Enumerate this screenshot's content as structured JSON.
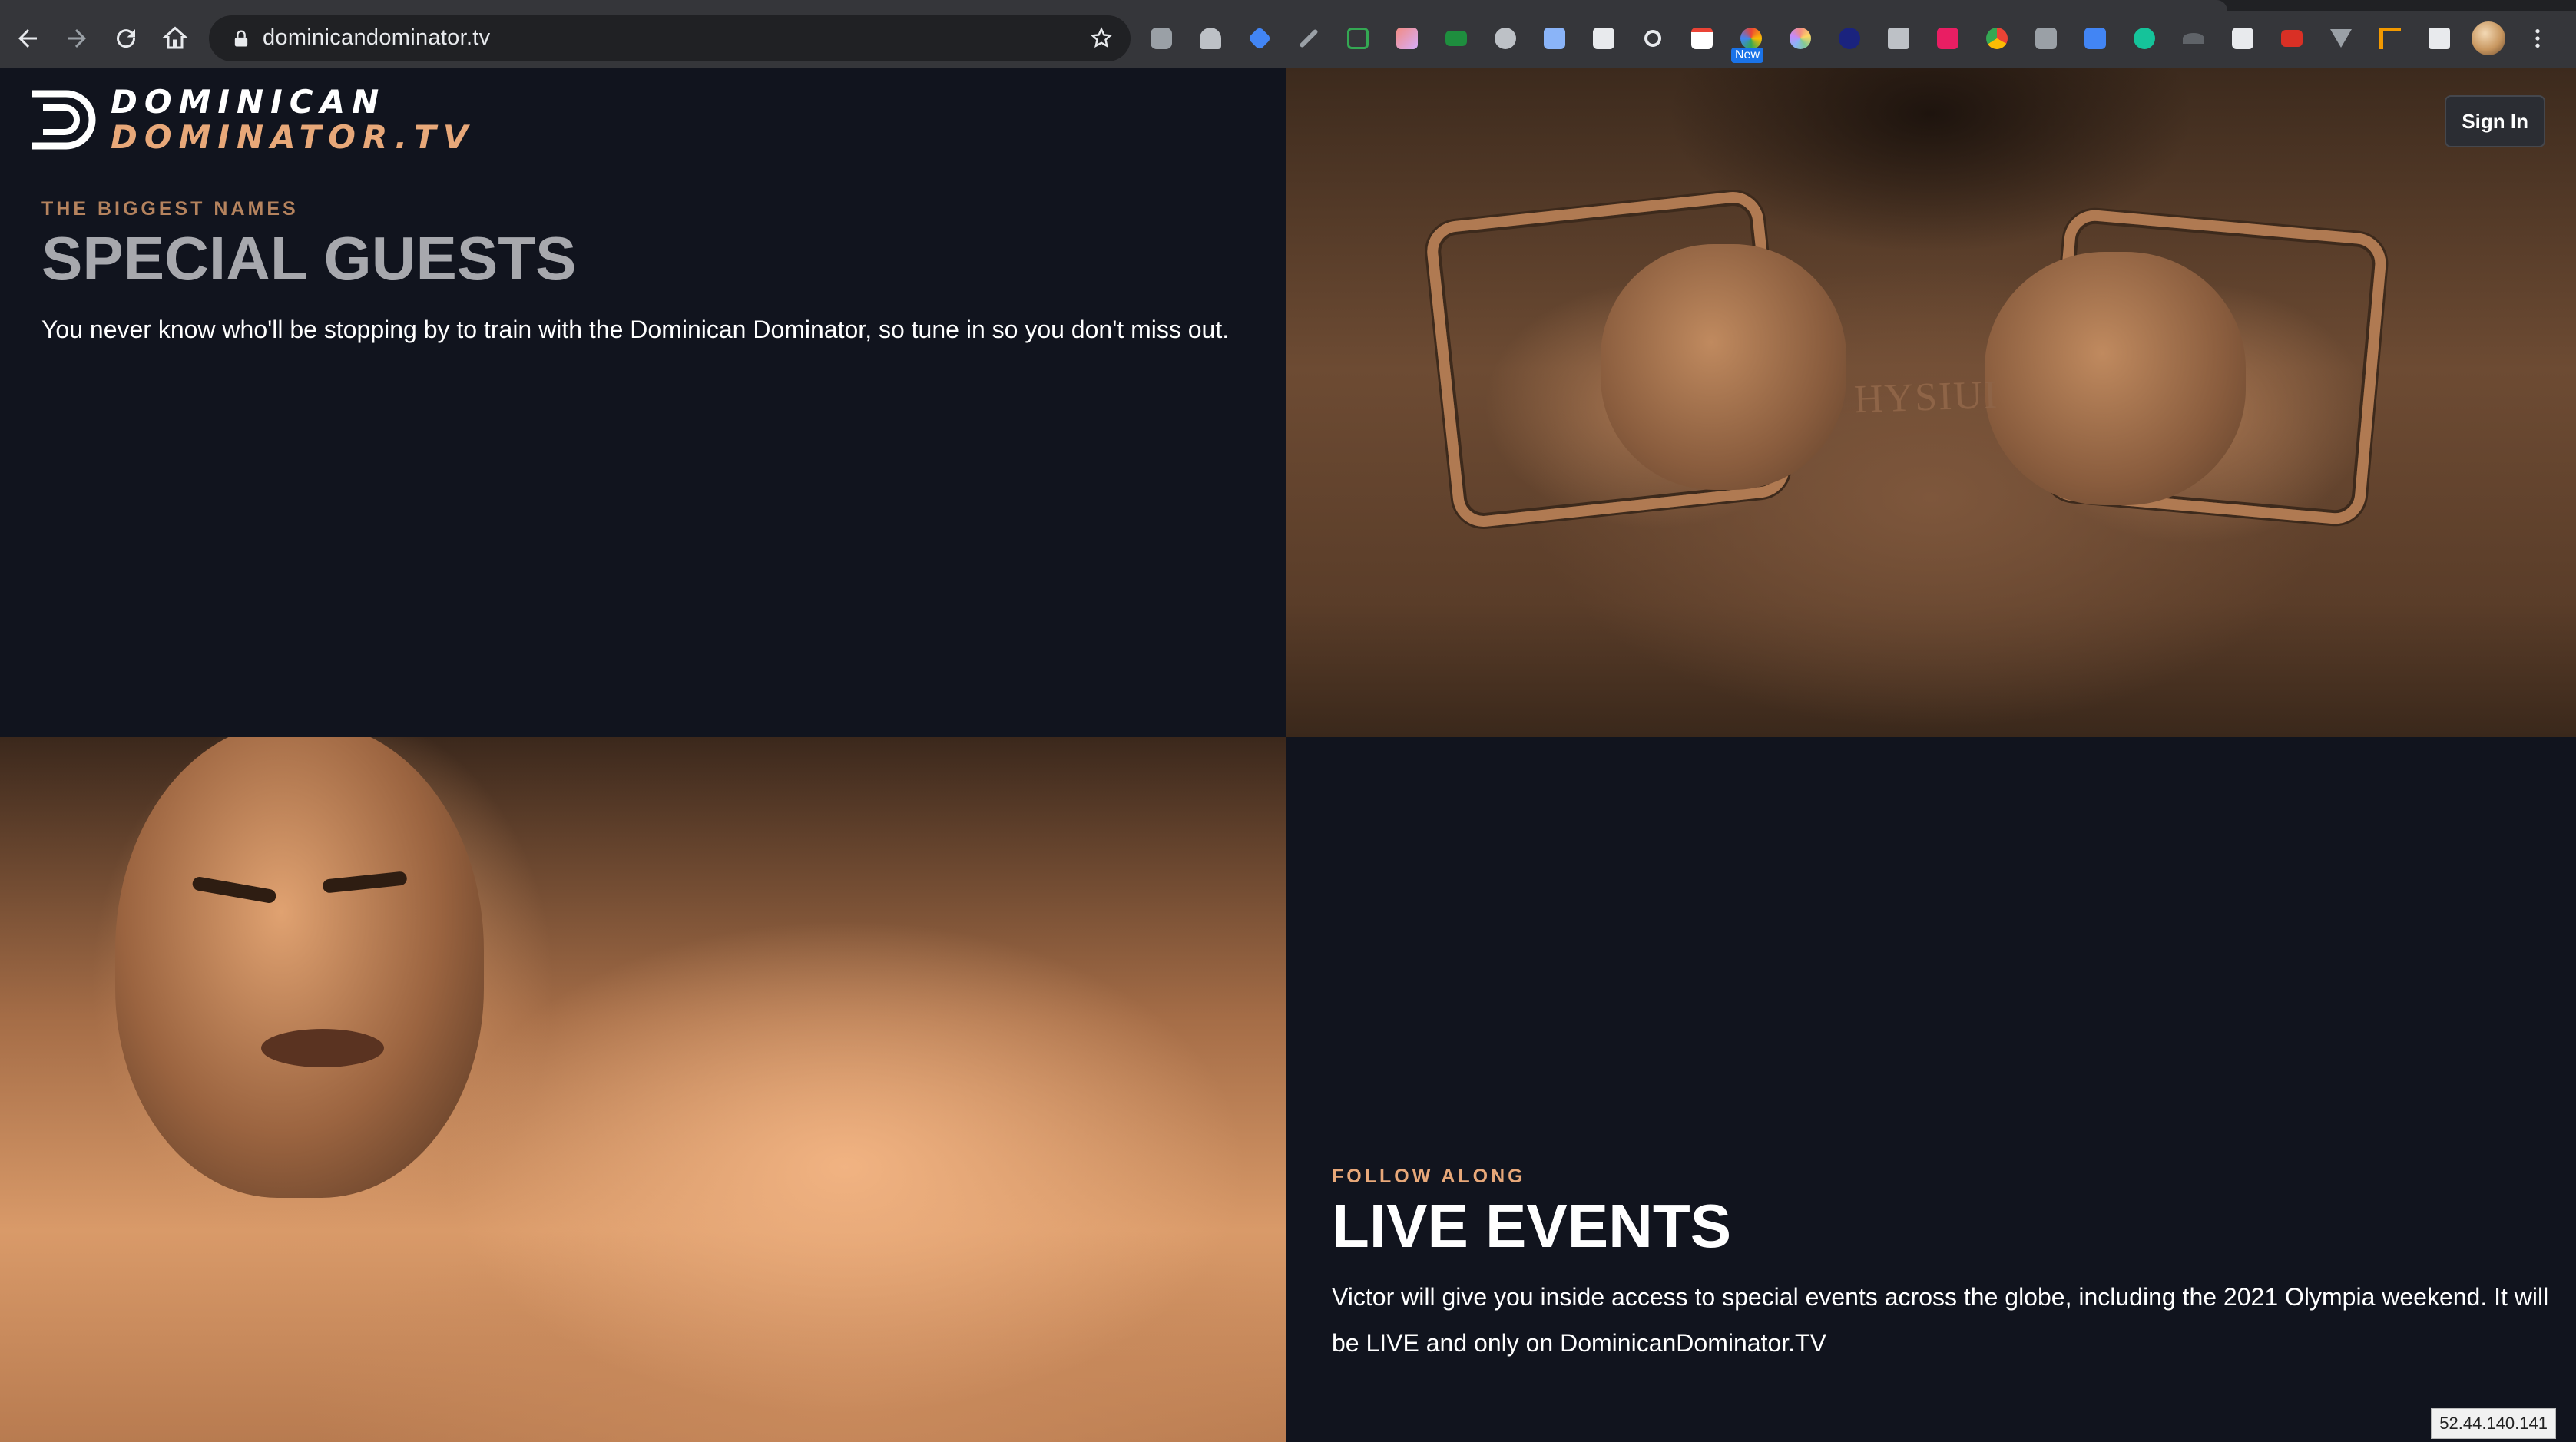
{
  "browser": {
    "url": "dominicandominator.tv",
    "extension_badge": "New",
    "colors": {
      "chrome": "#35363a",
      "omnibox": "#202124",
      "badge": "#1a73e8"
    }
  },
  "header": {
    "logo_line1": "DOMINICAN",
    "logo_line2": "DOMINATOR.TV",
    "sign_in_label": "Sign In"
  },
  "guests": {
    "eyebrow": "THE BIGGEST NAMES",
    "title": "SPECIAL GUESTS",
    "body": "You never know who'll be stopping by to train with the Dominican Dominator, so tune in so you don't miss out.",
    "photo_shirt_text": "HYSIUI"
  },
  "live": {
    "eyebrow": "FOLLOW ALONG",
    "title": "LIVE EVENTS",
    "body": "Victor will give you inside access to special events across the globe, including the 2021 Olympia weekend. It will be LIVE and only on DominicanDominator.TV"
  },
  "footer": {
    "ip_label": "52.44.140.141"
  },
  "theme": {
    "background": "#11141e",
    "accent": "#e8a879",
    "muted_heading": "#a7a8ad"
  }
}
